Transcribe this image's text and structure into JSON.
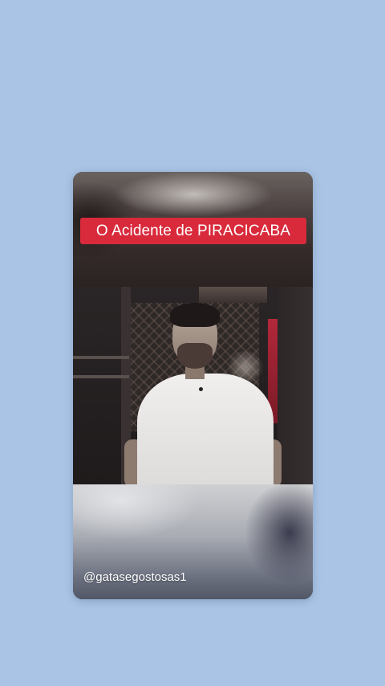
{
  "overlay": {
    "title": "O Acidente de PIRACICABA",
    "handle": "@gatasegostosas1"
  },
  "colors": {
    "page_background": "#a9c4e5",
    "title_badge": "#d82a3b",
    "title_text": "#ffffff",
    "handle_text": "#ffffff"
  }
}
